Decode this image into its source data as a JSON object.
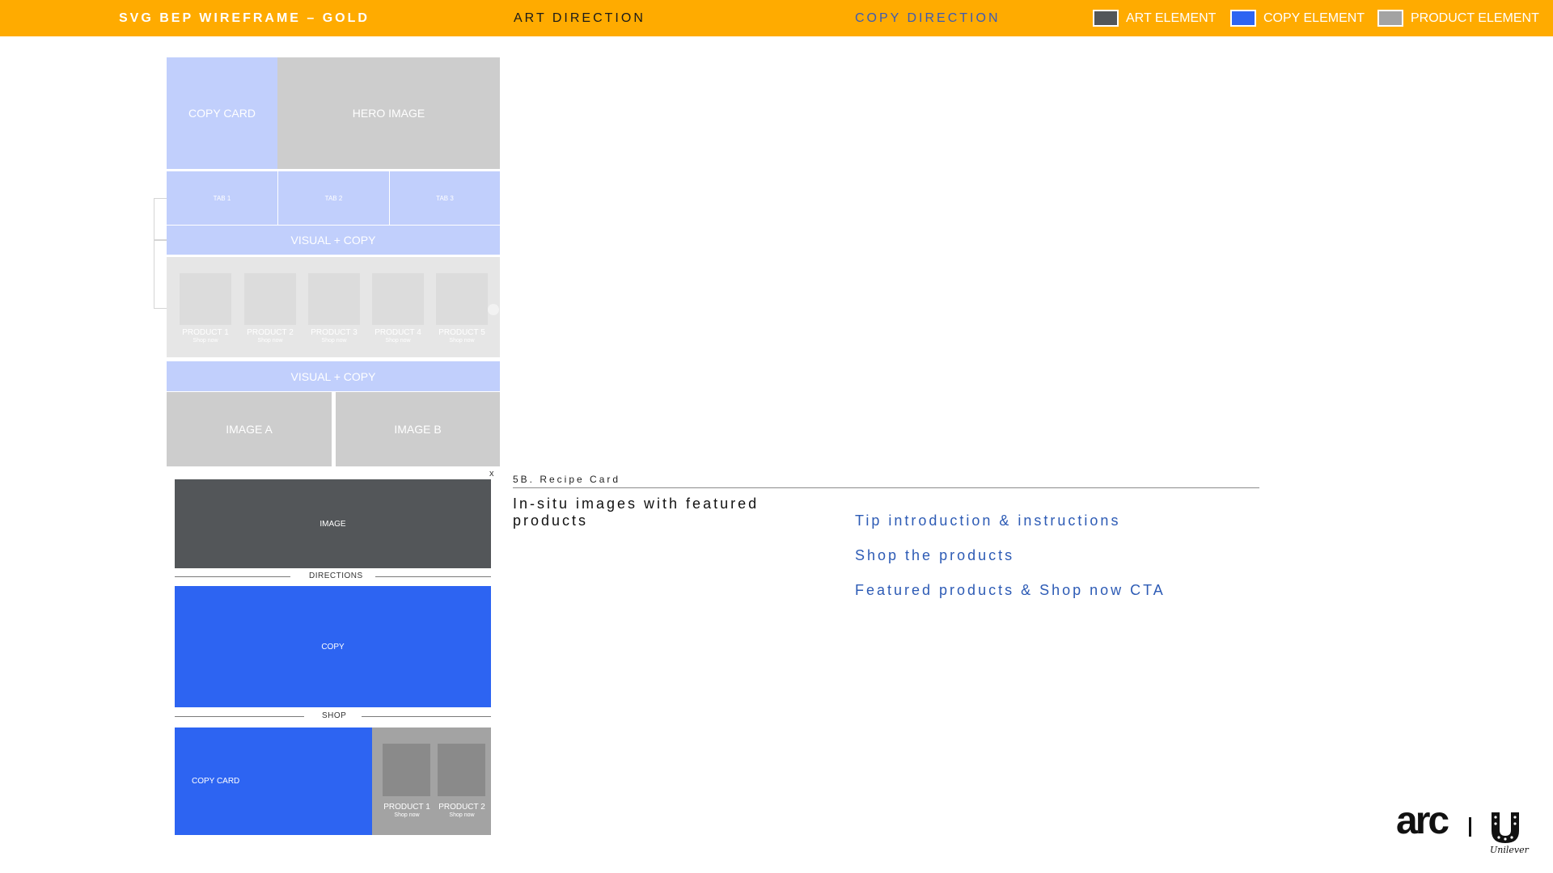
{
  "header": {
    "title": "SVG BEP WIREFRAME – GOLD",
    "art_direction": "ART DIRECTION",
    "copy_direction": "COPY DIRECTION",
    "legend": [
      {
        "label": "ART ELEMENT",
        "color": "#535659"
      },
      {
        "label": "COPY ELEMENT",
        "color": "#2D64F2"
      },
      {
        "label": "PRODUCT ELEMENT",
        "color": "#A3A3A3"
      }
    ]
  },
  "wireframe": {
    "top": {
      "copy_card": "COPY CARD",
      "hero_image": "HERO IMAGE",
      "tabs": [
        "TAB 1",
        "TAB 2",
        "TAB 3"
      ],
      "visual_copy_1": "VISUAL + COPY",
      "products": [
        {
          "name": "PRODUCT 1",
          "cta": "Shop now"
        },
        {
          "name": "PRODUCT 2",
          "cta": "Shop now"
        },
        {
          "name": "PRODUCT 3",
          "cta": "Shop now"
        },
        {
          "name": "PRODUCT 4",
          "cta": "Shop now"
        },
        {
          "name": "PRODUCT 5",
          "cta": "Shop now"
        }
      ],
      "visual_copy_2": "VISUAL + COPY",
      "image_a": "IMAGE A",
      "image_b": "IMAGE B"
    },
    "modal": {
      "close": "x",
      "image": "IMAGE",
      "directions": "DIRECTIONS",
      "copy": "COPY",
      "shop": "SHOP",
      "copy_card": "COPY CARD",
      "products": [
        {
          "name": "PRODUCT 1",
          "cta": "Shop now"
        },
        {
          "name": "PRODUCT 2",
          "cta": "Shop now"
        }
      ]
    }
  },
  "section": {
    "label": "5B. Recipe Card",
    "art_direction": "In-situ images with featured products",
    "copy_direction": [
      "Tip introduction & instructions",
      "Shop the products",
      "Featured products & Shop now CTA"
    ]
  },
  "logo": {
    "arc": "arc",
    "unilever": "Unilever"
  }
}
